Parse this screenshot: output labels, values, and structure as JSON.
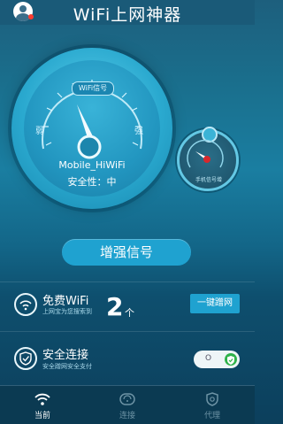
{
  "header": {
    "title": "WiFi上网神器",
    "avatar_icon": "user-avatar-icon"
  },
  "gauge": {
    "badge": "WiFi信号",
    "weak_label": "弱",
    "strong_label": "强",
    "ssid": "Mobile_HiWiFi",
    "security": "安全性：中"
  },
  "mini_gauge": {
    "label": "手机信号增"
  },
  "boost": {
    "label": "增强信号"
  },
  "free_wifi": {
    "title": "免费WiFi",
    "subtitle": "上网宝为您搜索到",
    "count": "2",
    "unit": "个",
    "button": "一键蹭网"
  },
  "secure": {
    "title": "安全连接",
    "subtitle": "安全蹭网安全支付",
    "toggle_state": "O"
  },
  "tabs": [
    {
      "label": "当前",
      "icon": "wifi-icon",
      "active": true
    },
    {
      "label": "连接",
      "icon": "wifi-badge-icon",
      "active": false
    },
    {
      "label": "代理",
      "icon": "shield-icon",
      "active": false
    }
  ],
  "colors": {
    "accent": "#1fa2d0",
    "background_top": "#1d5f7d",
    "toggle_on": "#2fb24a",
    "badge_dot": "#ff3b30"
  }
}
